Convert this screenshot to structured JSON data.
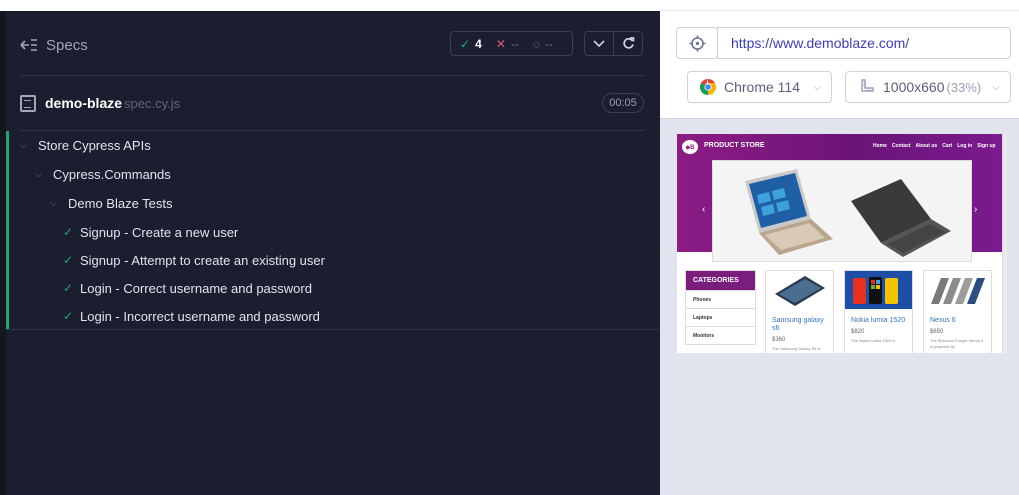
{
  "reporter": {
    "header_label": "Specs",
    "stats": {
      "passed": "4",
      "failed": "--",
      "pending": "--"
    },
    "spec": {
      "name": "demo-blaze",
      "ext": "spec.cy.js",
      "duration": "00:05"
    },
    "tree": {
      "suite1": "Store Cypress APIs",
      "suite2": "Cypress.Commands",
      "suite3": "Demo Blaze Tests",
      "tests": [
        "Signup - Create a new user",
        "Signup - Attempt to create an existing user",
        "Login - Correct username and password",
        "Login - Incorrect username and password"
      ]
    }
  },
  "aut_header": {
    "url": "https://www.demoblaze.com/",
    "browser": "Chrome 114",
    "viewport": "1000x660",
    "scale": "(33%)"
  },
  "aut": {
    "brand": "PRODUCT STORE",
    "nav": [
      "Home",
      "Contact",
      "About us",
      "Cart",
      "Log in",
      "Sign up"
    ],
    "categories_title": "CATEGORIES",
    "categories": [
      "Phones",
      "Laptops",
      "Monitors"
    ],
    "products": [
      {
        "name": "Samsung galaxy s6",
        "price": "$360",
        "desc": "The Samsung Galaxy S6 is"
      },
      {
        "name": "Nokia lumia 1520",
        "price": "$820",
        "desc": "The Nokia Lumia 1520 is"
      },
      {
        "name": "Nexus 6",
        "price": "$650",
        "desc": "The Motorola Google Nexus 6 is powered by"
      }
    ]
  },
  "colors": {
    "pass": "#1fa971",
    "fail": "#e45770",
    "accent": "#3a3fb8",
    "brand": "#8d1c85"
  }
}
